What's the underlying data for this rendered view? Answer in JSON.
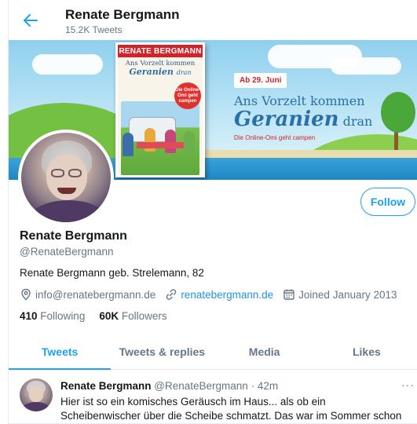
{
  "header": {
    "name": "Renate Bergmann",
    "tweet_count": "15.2K Tweets"
  },
  "banner": {
    "book": {
      "author": "RENATE BERGMANN",
      "title_line1": "Ans Vorzelt kommen",
      "title_big": "Geranien",
      "title_small": "dran",
      "sticker": "Die Online-Omi geht campen"
    },
    "promo": {
      "date": "Ab 29. Juni",
      "line1": "Ans Vorzelt kommen",
      "line2_big": "Geranien",
      "line2_small": "dran",
      "line3": "Die Online-Omi geht campen"
    }
  },
  "profile": {
    "name": "Renate Bergmann",
    "handle": "@RenateBergmann",
    "bio": "Renate Bergmann geb. Strelemann, 82",
    "email": "info@renatebergmann.de",
    "website": "renatebergmann.de",
    "joined": "Joined January 2013",
    "following_count": "410",
    "following_label": "Following",
    "followers_count": "60K",
    "followers_label": "Followers",
    "follow_button": "Follow"
  },
  "tabs": [
    {
      "label": "Tweets",
      "active": true
    },
    {
      "label": "Tweets & replies",
      "active": false
    },
    {
      "label": "Media",
      "active": false
    },
    {
      "label": "Likes",
      "active": false
    }
  ],
  "tweet": {
    "name": "Renate Bergmann",
    "meta": "@RenateBergmann · 42m",
    "more": "···",
    "text": "Hier ist so ein komisches Geräusch im Haus... als ob ein Scheibenwischer über die Scheibe schmatzt. Das war im Sommer schon mal, da hat die"
  },
  "colors": {
    "accent": "#1da1f2",
    "link": "#1b95e0",
    "muted": "#657786",
    "text": "#14171a"
  },
  "icons": [
    "back-arrow-icon",
    "mail-icon",
    "link-icon",
    "calendar-icon",
    "more-icon"
  ]
}
